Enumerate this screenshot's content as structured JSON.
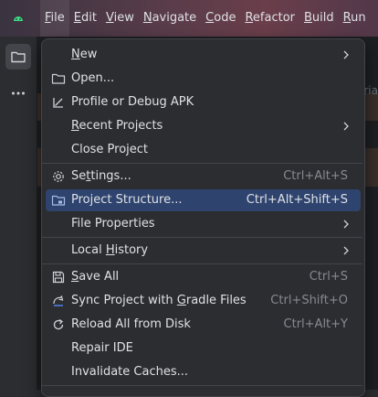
{
  "menubar": {
    "items": [
      {
        "pre": "",
        "m": "F",
        "post": "ile"
      },
      {
        "pre": "",
        "m": "E",
        "post": "dit"
      },
      {
        "pre": "",
        "m": "V",
        "post": "iew"
      },
      {
        "pre": "",
        "m": "N",
        "post": "avigate"
      },
      {
        "pre": "",
        "m": "C",
        "post": "ode"
      },
      {
        "pre": "",
        "m": "R",
        "post": "efactor"
      },
      {
        "pre": "",
        "m": "B",
        "post": "uild"
      },
      {
        "pre": "",
        "m": "R",
        "post": "un"
      }
    ]
  },
  "background": {
    "tab_fragment": "aria"
  },
  "file_menu": {
    "new": {
      "pre": "",
      "m": "N",
      "post": "ew"
    },
    "open": {
      "pre": "",
      "m": "",
      "post": "Open..."
    },
    "profile": {
      "pre": "",
      "m": "",
      "post": "Profile or Debug APK"
    },
    "recent": {
      "pre": "",
      "m": "R",
      "post": "ecent Projects"
    },
    "close": {
      "pre": "",
      "m": "",
      "post": "Close Project"
    },
    "settings": {
      "pre": "Se",
      "m": "t",
      "post": "tings...",
      "shortcut": "Ctrl+Alt+S"
    },
    "structure": {
      "pre": "",
      "m": "",
      "post": "Project Structure...",
      "shortcut": "Ctrl+Alt+Shift+S"
    },
    "fileprops": {
      "pre": "",
      "m": "",
      "post": "File Properties"
    },
    "history": {
      "pre": "Local ",
      "m": "H",
      "post": "istory"
    },
    "saveall": {
      "pre": "",
      "m": "S",
      "post": "ave All",
      "shortcut": "Ctrl+S"
    },
    "sync": {
      "pre": "Sync Project with ",
      "m": "G",
      "post": "radle Files",
      "shortcut": "Ctrl+Shift+O"
    },
    "reload": {
      "pre": "",
      "m": "",
      "post": "Reload All from Disk",
      "shortcut": "Ctrl+Alt+Y"
    },
    "repair": {
      "pre": "",
      "m": "",
      "post": "Repair IDE"
    },
    "invalidate": {
      "pre": "",
      "m": "",
      "post": "Invalidate Caches..."
    }
  },
  "colors": {
    "accent_selected": "#2e436e",
    "menu_bg": "#2b2d30",
    "shortcut": "#868a91"
  },
  "icons": {
    "folder": "folder-icon",
    "profile": "profile-apk-icon",
    "gear": "gear-icon",
    "structure": "project-structure-icon",
    "save": "save-icon",
    "sync": "gradle-sync-icon",
    "reload": "reload-icon",
    "chevron": "chevron-right-icon"
  }
}
